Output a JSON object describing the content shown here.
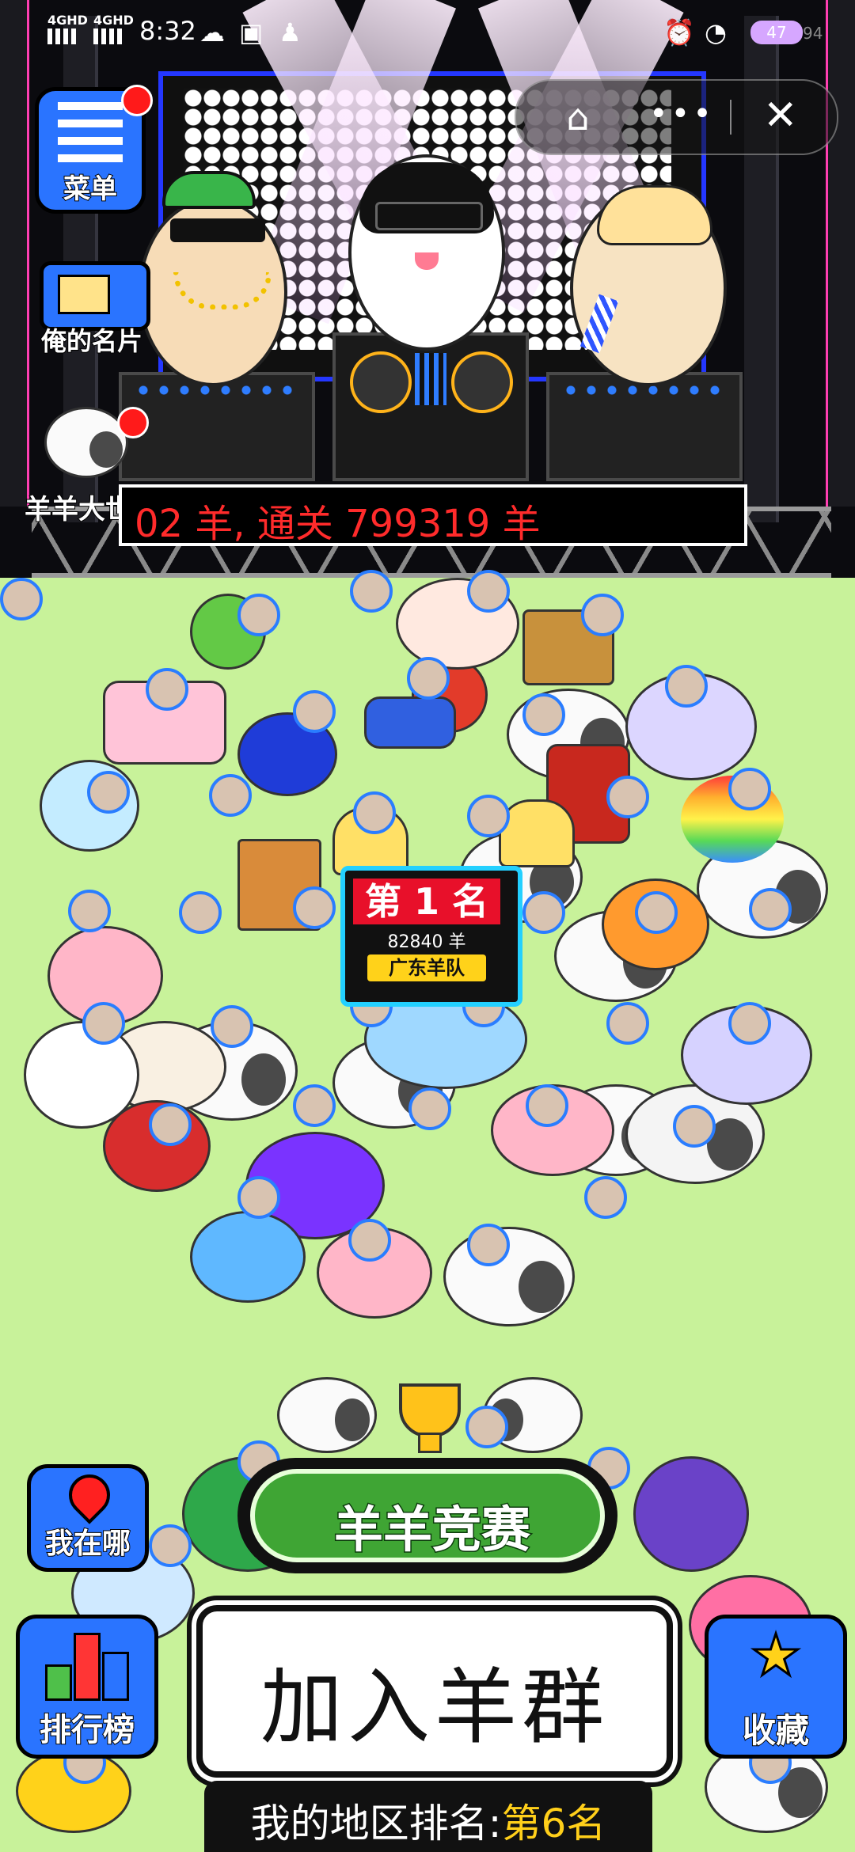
{
  "status_bar": {
    "network_1": "4GHD",
    "network_2": "4GHD",
    "time": "8:32",
    "battery": "47",
    "battery_extra": "94"
  },
  "side_buttons": {
    "menu": "菜单",
    "card": "俺的名片",
    "world": "羊羊大世界",
    "where": "我在哪",
    "leaderboard": "排行榜",
    "favorite": "收藏"
  },
  "marquee": "02 羊, 通关 799319 羊",
  "rank_sign": {
    "title": "第 1 名",
    "count": "82840 羊",
    "team": "广东羊队"
  },
  "race_button": "羊羊竞赛",
  "join_button": "加入羊群",
  "region_rank": {
    "label": "我的地区排名:",
    "value": "第6名"
  },
  "icons": [
    "home-icon",
    "more-icon",
    "close-icon",
    "menu-list-icon",
    "name-card-icon",
    "location-pin-icon",
    "bar-chart-icon",
    "star-icon",
    "trophy-icon"
  ],
  "colors": {
    "accent_green": "#3fa534",
    "rank_red": "#e8102a",
    "rank_yellow": "#ffd21a",
    "region_value": "#ffcf1a",
    "grass": "#c8f29a"
  }
}
